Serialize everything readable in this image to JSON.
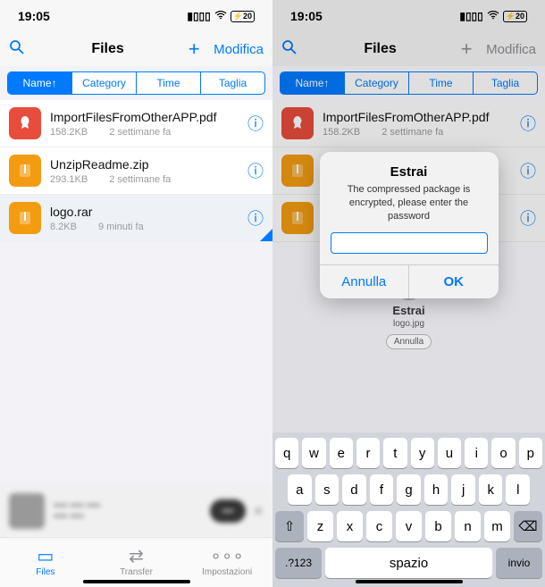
{
  "status": {
    "time": "19:05",
    "battery": "20"
  },
  "header": {
    "title": "Files",
    "edit": "Modifica"
  },
  "segments": [
    "Name↑",
    "Category",
    "Time",
    "Taglia"
  ],
  "files": [
    {
      "icon": "pdf",
      "name": "ImportFilesFromOtherAPP.pdf",
      "size": "158.2KB",
      "age": "2 settimane fa"
    },
    {
      "icon": "zip",
      "name": "UnzipReadme.zip",
      "size": "293.1KB",
      "age": "2 settimane fa"
    },
    {
      "icon": "zip",
      "name": "logo.rar",
      "size": "8.2KB",
      "age": "9 minuti fa"
    }
  ],
  "tabs": [
    {
      "label": "Files",
      "icon": "folder"
    },
    {
      "label": "Transfer",
      "icon": "transfer"
    },
    {
      "label": "Impostazioni",
      "icon": "more"
    }
  ],
  "dialog": {
    "title": "Estrai",
    "message": "The compressed package is encrypted, please enter the password",
    "cancel": "Annulla",
    "ok": "OK"
  },
  "progress": {
    "title": "Estrai",
    "file": "logo.jpg",
    "cancel": "Annulla"
  },
  "keyboard": {
    "row1": [
      "q",
      "w",
      "e",
      "r",
      "t",
      "y",
      "u",
      "i",
      "o",
      "p"
    ],
    "row2": [
      "a",
      "s",
      "d",
      "f",
      "g",
      "h",
      "j",
      "k",
      "l"
    ],
    "row3": [
      "z",
      "x",
      "c",
      "v",
      "b",
      "n",
      "m"
    ],
    "num": ".?123",
    "space": "spazio",
    "return": "invio"
  }
}
